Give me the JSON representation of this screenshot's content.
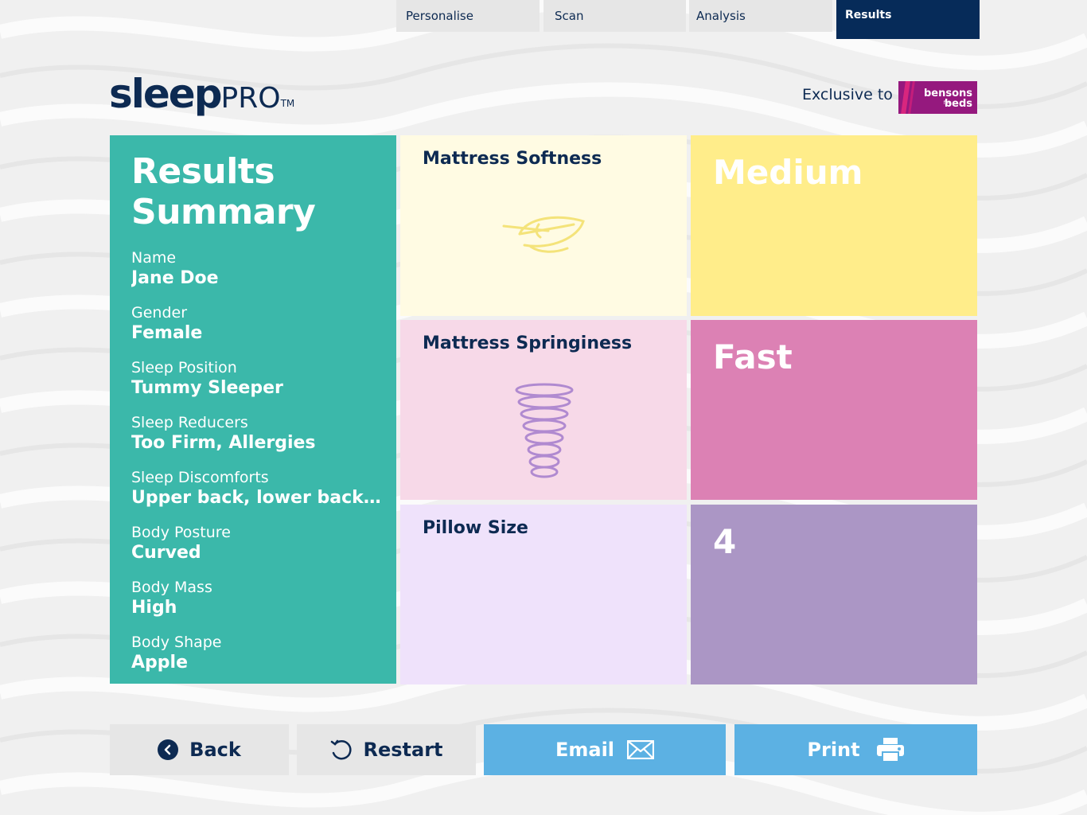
{
  "tabs": [
    {
      "label": "Personalise",
      "active": false
    },
    {
      "label": "Scan",
      "active": false
    },
    {
      "label": "Analysis",
      "active": false
    },
    {
      "label": "Results",
      "active": true
    }
  ],
  "header": {
    "logo_sleep": "sleep",
    "logo_pro": "PRO",
    "logo_tm": "TM",
    "exclusive_text": "Exclusive to",
    "partner_logo": {
      "line1": "bensons",
      "small": "for",
      "line2": "beds"
    }
  },
  "summary": {
    "title_line1": "Results",
    "title_line2": "Summary",
    "fields": [
      {
        "label": "Name",
        "value": "Jane Doe"
      },
      {
        "label": "Gender",
        "value": "Female"
      },
      {
        "label": "Sleep Position",
        "value": "Tummy Sleeper"
      },
      {
        "label": "Sleep Reducers",
        "value": "Too Firm, Allergies"
      },
      {
        "label": "Sleep Discomforts",
        "value": "Upper back, lower back, l..."
      },
      {
        "label": "Body Posture",
        "value": "Curved"
      },
      {
        "label": "Body Mass",
        "value": "High"
      },
      {
        "label": "Body Shape",
        "value": "Apple"
      }
    ]
  },
  "results": [
    {
      "label": "Mattress Softness",
      "value": "Medium",
      "icon": "feather-icon",
      "label_bg": "#fffbe3",
      "value_bg": "#ffed8a"
    },
    {
      "label": "Mattress Springiness",
      "value": "Fast",
      "icon": "spring-icon",
      "label_bg": "#f7d9e8",
      "value_bg": "#dc81b4"
    },
    {
      "label": "Pillow Size",
      "value": "4",
      "icon": "",
      "label_bg": "#efe2fb",
      "value_bg": "#ab96c5"
    }
  ],
  "buttons": {
    "back": "Back",
    "restart": "Restart",
    "email": "Email",
    "print": "Print"
  },
  "colors": {
    "navy": "#0d2a52",
    "teal": "#3bb8aa",
    "button_blue": "#5cb1e3",
    "button_grey": "#e6e6e6"
  }
}
